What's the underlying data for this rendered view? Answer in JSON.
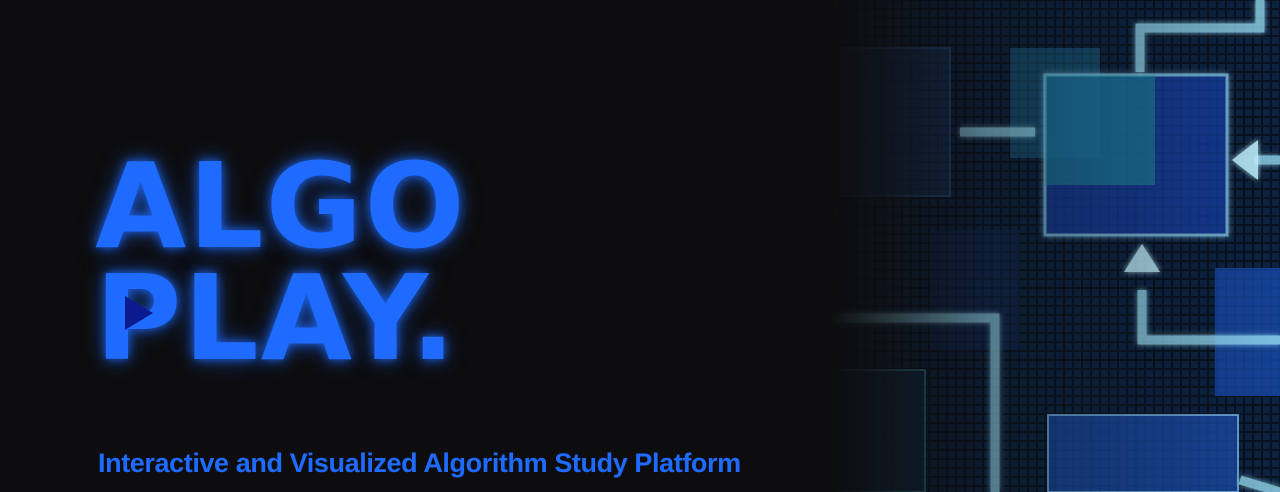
{
  "hero": {
    "title_line1": "ALGO",
    "title_line2": "PLAY.",
    "subtitle": "Interactive and Visualized Algorithm Study Platform"
  },
  "colors": {
    "background": "#0d0d0f",
    "accent": "#1f6bff",
    "logo_triangle": "#0a1a8f"
  },
  "icons": {
    "logo_mark": "play-triangle-icon",
    "decorative_graphic": "flowchart-illustration"
  }
}
